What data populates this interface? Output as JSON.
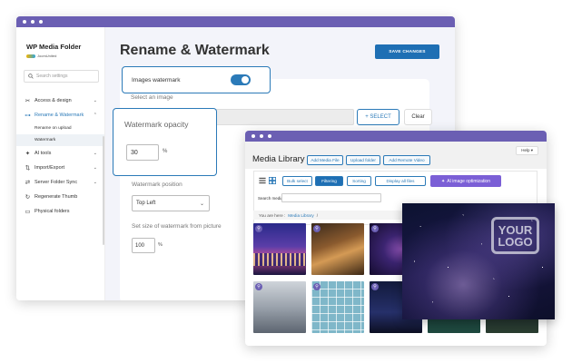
{
  "app": {
    "brand_name": "WP Media Folder",
    "brand_by": "JoomUnited"
  },
  "sidebar": {
    "search_placeholder": "Search settings",
    "items": [
      {
        "label": "Access & design",
        "icon": "tools-icon"
      },
      {
        "label": "Rename & Watermark",
        "icon": "rename-icon",
        "active": true
      },
      {
        "label": "AI tools",
        "icon": "ai-icon"
      },
      {
        "label": "Import/Export",
        "icon": "import-export-icon"
      },
      {
        "label": "Server Folder Sync",
        "icon": "sync-icon"
      },
      {
        "label": "Regenerate Thumb",
        "icon": "regenerate-icon"
      },
      {
        "label": "Physical folders",
        "icon": "folder-icon"
      }
    ],
    "subitems": [
      {
        "label": "Rename on upload"
      },
      {
        "label": "Watermark",
        "active": true
      }
    ]
  },
  "main": {
    "title": "Rename & Watermark",
    "save_label": "SAVE CHANGES",
    "images_watermark_label": "Images watermark",
    "images_watermark_on": true,
    "select_image_label": "Select an image",
    "select_btn": "+ SELECT",
    "clear_btn": "Clear",
    "opacity_label": "Watermark opacity",
    "opacity_value": "30",
    "opacity_unit": "%",
    "position_label": "Watermark position",
    "position_value": "Top Left",
    "size_label": "Set size of watermark from picture",
    "size_value": "100",
    "size_unit": "%"
  },
  "media_library": {
    "help_label": "Help ▾",
    "title": "Media Library",
    "add_media": "Add Media File",
    "upload_folder": "Upload folder",
    "add_remote_video": "Add Remote Video",
    "bulk_select": "Bulk select",
    "filtering": "Filtering",
    "sorting": "Sorting",
    "display_all": "Display all files",
    "ai_label": "AI image optimization",
    "search_label": "Search media",
    "breadcrumb_prefix": "You are here :",
    "breadcrumb_link": "Media Library",
    "breadcrumb_sep": "/"
  },
  "preview": {
    "watermark_line1": "YOUR",
    "watermark_line2": "LOGO"
  },
  "colors": {
    "titlebar": "#6b5fb3",
    "accent": "#2b7ab8",
    "primary_button": "#1e6fb4",
    "ai_button": "#7b5fd6"
  }
}
